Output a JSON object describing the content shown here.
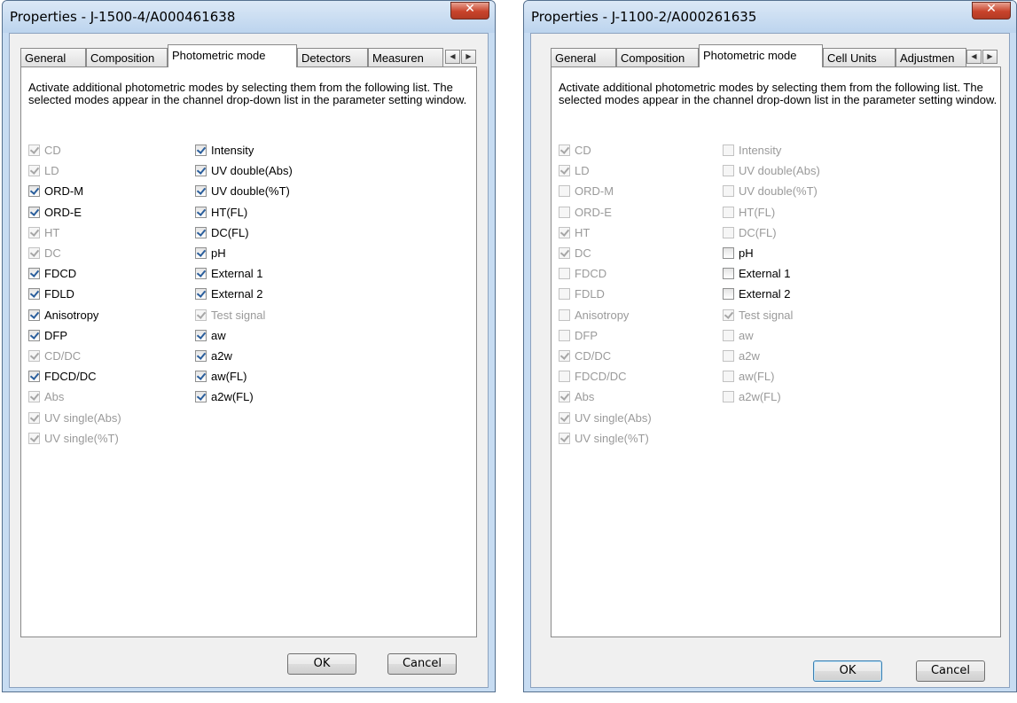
{
  "left_dialog": {
    "title": "Properties - J-1500-4/A000461638",
    "close_label": "✕",
    "tabs": [
      "General",
      "Composition",
      "Photometric mode",
      "Detectors",
      "Measuren"
    ],
    "description": "Activate additional photometric modes by selecting them from the following list. The selected modes appear in the channel drop-down list in the parameter setting window.",
    "col1": [
      {
        "label": "CD",
        "checked": true,
        "disabled": true
      },
      {
        "label": "LD",
        "checked": true,
        "disabled": true
      },
      {
        "label": "ORD-M",
        "checked": true,
        "disabled": false
      },
      {
        "label": "ORD-E",
        "checked": true,
        "disabled": false
      },
      {
        "label": "HT",
        "checked": true,
        "disabled": true
      },
      {
        "label": "DC",
        "checked": true,
        "disabled": true
      },
      {
        "label": "FDCD",
        "checked": true,
        "disabled": false
      },
      {
        "label": "FDLD",
        "checked": true,
        "disabled": false
      },
      {
        "label": "Anisotropy",
        "checked": true,
        "disabled": false
      },
      {
        "label": "DFP",
        "checked": true,
        "disabled": false
      },
      {
        "label": "CD/DC",
        "checked": true,
        "disabled": true
      },
      {
        "label": "FDCD/DC",
        "checked": true,
        "disabled": false
      },
      {
        "label": "Abs",
        "checked": true,
        "disabled": true
      },
      {
        "label": "UV single(Abs)",
        "checked": true,
        "disabled": true
      },
      {
        "label": "UV single(%T)",
        "checked": true,
        "disabled": true
      }
    ],
    "col2": [
      {
        "label": "Intensity",
        "checked": true,
        "disabled": false
      },
      {
        "label": "UV double(Abs)",
        "checked": true,
        "disabled": false
      },
      {
        "label": "UV double(%T)",
        "checked": true,
        "disabled": false
      },
      {
        "label": "HT(FL)",
        "checked": true,
        "disabled": false
      },
      {
        "label": "DC(FL)",
        "checked": true,
        "disabled": false
      },
      {
        "label": "pH",
        "checked": true,
        "disabled": false
      },
      {
        "label": "External 1",
        "checked": true,
        "disabled": false
      },
      {
        "label": "External 2",
        "checked": true,
        "disabled": false
      },
      {
        "label": "Test signal",
        "checked": true,
        "disabled": true
      },
      {
        "label": "aw",
        "checked": true,
        "disabled": false
      },
      {
        "label": "a2w",
        "checked": true,
        "disabled": false
      },
      {
        "label": "aw(FL)",
        "checked": true,
        "disabled": false
      },
      {
        "label": "a2w(FL)",
        "checked": true,
        "disabled": false
      }
    ],
    "ok_label": "OK",
    "cancel_label": "Cancel"
  },
  "right_dialog": {
    "title": "Properties - J-1100-2/A000261635",
    "close_label": "✕",
    "tabs": [
      "General",
      "Composition",
      "Photometric mode",
      "Cell Units",
      "Adjustmen"
    ],
    "description": "Activate additional photometric modes by selecting them from the following list. The selected modes appear in the channel drop-down list in the parameter setting window.",
    "col1": [
      {
        "label": "CD",
        "checked": true,
        "disabled": true
      },
      {
        "label": "LD",
        "checked": true,
        "disabled": true
      },
      {
        "label": "ORD-M",
        "checked": false,
        "disabled": true
      },
      {
        "label": "ORD-E",
        "checked": false,
        "disabled": true
      },
      {
        "label": "HT",
        "checked": true,
        "disabled": true
      },
      {
        "label": "DC",
        "checked": true,
        "disabled": true
      },
      {
        "label": "FDCD",
        "checked": false,
        "disabled": true
      },
      {
        "label": "FDLD",
        "checked": false,
        "disabled": true
      },
      {
        "label": "Anisotropy",
        "checked": false,
        "disabled": true
      },
      {
        "label": "DFP",
        "checked": false,
        "disabled": true
      },
      {
        "label": "CD/DC",
        "checked": true,
        "disabled": true
      },
      {
        "label": "FDCD/DC",
        "checked": false,
        "disabled": true
      },
      {
        "label": "Abs",
        "checked": true,
        "disabled": true
      },
      {
        "label": "UV single(Abs)",
        "checked": true,
        "disabled": true
      },
      {
        "label": "UV single(%T)",
        "checked": true,
        "disabled": true
      }
    ],
    "col2": [
      {
        "label": "Intensity",
        "checked": false,
        "disabled": true
      },
      {
        "label": "UV double(Abs)",
        "checked": false,
        "disabled": true
      },
      {
        "label": "UV double(%T)",
        "checked": false,
        "disabled": true
      },
      {
        "label": "HT(FL)",
        "checked": false,
        "disabled": true
      },
      {
        "label": "DC(FL)",
        "checked": false,
        "disabled": true
      },
      {
        "label": "pH",
        "checked": false,
        "disabled": false
      },
      {
        "label": "External 1",
        "checked": false,
        "disabled": false
      },
      {
        "label": "External 2",
        "checked": false,
        "disabled": false
      },
      {
        "label": "Test signal",
        "checked": true,
        "disabled": true
      },
      {
        "label": "aw",
        "checked": false,
        "disabled": true
      },
      {
        "label": "a2w",
        "checked": false,
        "disabled": true
      },
      {
        "label": "aw(FL)",
        "checked": false,
        "disabled": true
      },
      {
        "label": "a2w(FL)",
        "checked": false,
        "disabled": true
      }
    ],
    "ok_label": "OK",
    "cancel_label": "Cancel"
  }
}
